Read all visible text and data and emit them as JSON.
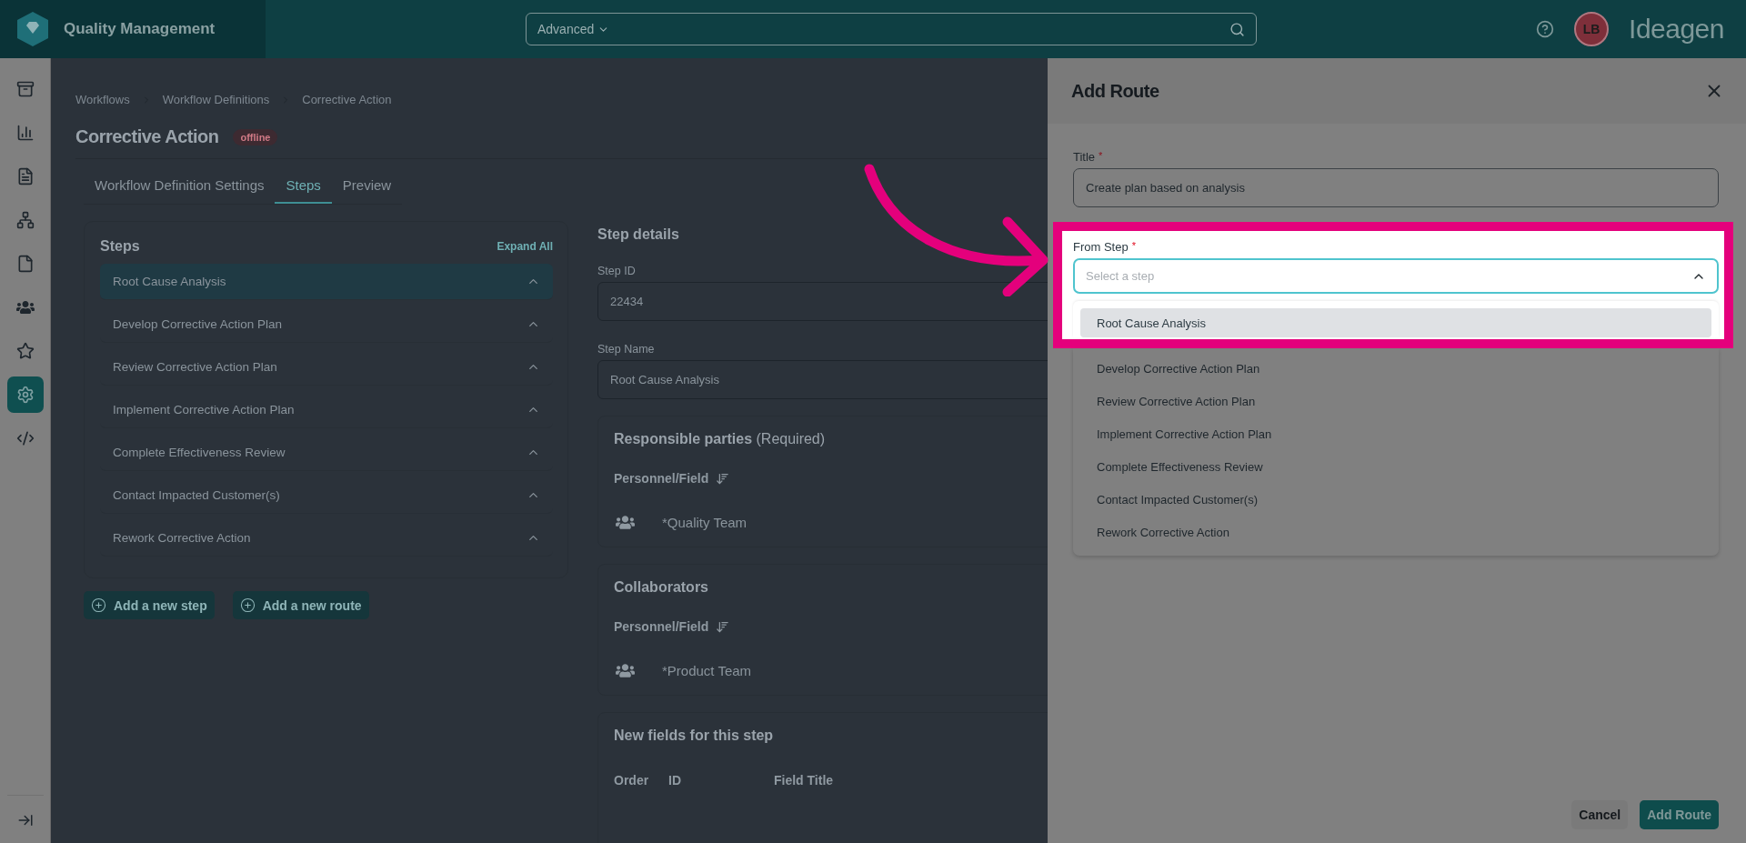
{
  "app": {
    "title": "Quality Management"
  },
  "search": {
    "scope": "Advanced"
  },
  "user": {
    "initials": "LB"
  },
  "brand": "Ideagen",
  "sidebar": {
    "items": [
      {
        "selected": false
      },
      {
        "selected": false
      },
      {
        "selected": false
      },
      {
        "selected": false
      },
      {
        "selected": false
      },
      {
        "selected": false
      },
      {
        "selected": false
      },
      {
        "selected": true
      },
      {
        "selected": false
      }
    ]
  },
  "breadcrumb": [
    "Workflows",
    "Workflow Definitions",
    "Corrective Action"
  ],
  "page": {
    "title": "Corrective Action",
    "status": "offline"
  },
  "tabs": [
    {
      "label": "Workflow Definition Settings",
      "selected": false
    },
    {
      "label": "Steps",
      "selected": true
    },
    {
      "label": "Preview",
      "selected": false
    }
  ],
  "steps_panel": {
    "title": "Steps",
    "expand_all": "Expand All",
    "items": [
      {
        "label": "Root Cause Analysis",
        "selected": true
      },
      {
        "label": "Develop Corrective Action Plan",
        "selected": false
      },
      {
        "label": "Review Corrective Action Plan",
        "selected": false
      },
      {
        "label": "Implement Corrective Action Plan",
        "selected": false
      },
      {
        "label": "Complete Effectiveness Review",
        "selected": false
      },
      {
        "label": "Contact Impacted Customer(s)",
        "selected": false
      },
      {
        "label": "Rework Corrective Action",
        "selected": false
      }
    ]
  },
  "actions": [
    "Add a new step",
    "Add a new route"
  ],
  "step_details": {
    "title": "Step details",
    "fields": [
      {
        "label": "Step ID",
        "value": "22434"
      },
      {
        "label": "Step Name",
        "value": "Root Cause Analysis"
      }
    ],
    "sections": [
      {
        "title": "Responsible parties",
        "note": "(Required)",
        "column": "Personnel/Field",
        "entries": [
          "*Quality Team"
        ]
      },
      {
        "title": "Collaborators",
        "column": "Personnel/Field",
        "entries": [
          "*Product Team"
        ]
      }
    ],
    "new_fields": {
      "title": "New fields for this step",
      "columns": [
        "Order",
        "ID",
        "Field Title"
      ]
    }
  },
  "drawer": {
    "title": "Add Route",
    "title_field": {
      "label": "Title",
      "required_mark": "*",
      "value": "Create plan based on analysis"
    },
    "from_step": {
      "label": "From Step",
      "required_mark": "*",
      "placeholder": "Select a step",
      "expanded": true,
      "options": [
        {
          "label": "Root Cause Analysis",
          "selected": true
        },
        {
          "label": "Develop Corrective Action Plan",
          "selected": false
        },
        {
          "label": "Review Corrective Action Plan",
          "selected": false
        },
        {
          "label": "Implement Corrective Action Plan",
          "selected": false
        },
        {
          "label": "Complete Effectiveness Review",
          "selected": false
        },
        {
          "label": "Contact Impacted Customer(s)",
          "selected": false
        },
        {
          "label": "Rework Corrective Action",
          "selected": false
        }
      ]
    },
    "buttons": [
      {
        "label": "Cancel",
        "kind": "secondary"
      },
      {
        "label": "Add Route",
        "kind": "primary"
      }
    ]
  }
}
